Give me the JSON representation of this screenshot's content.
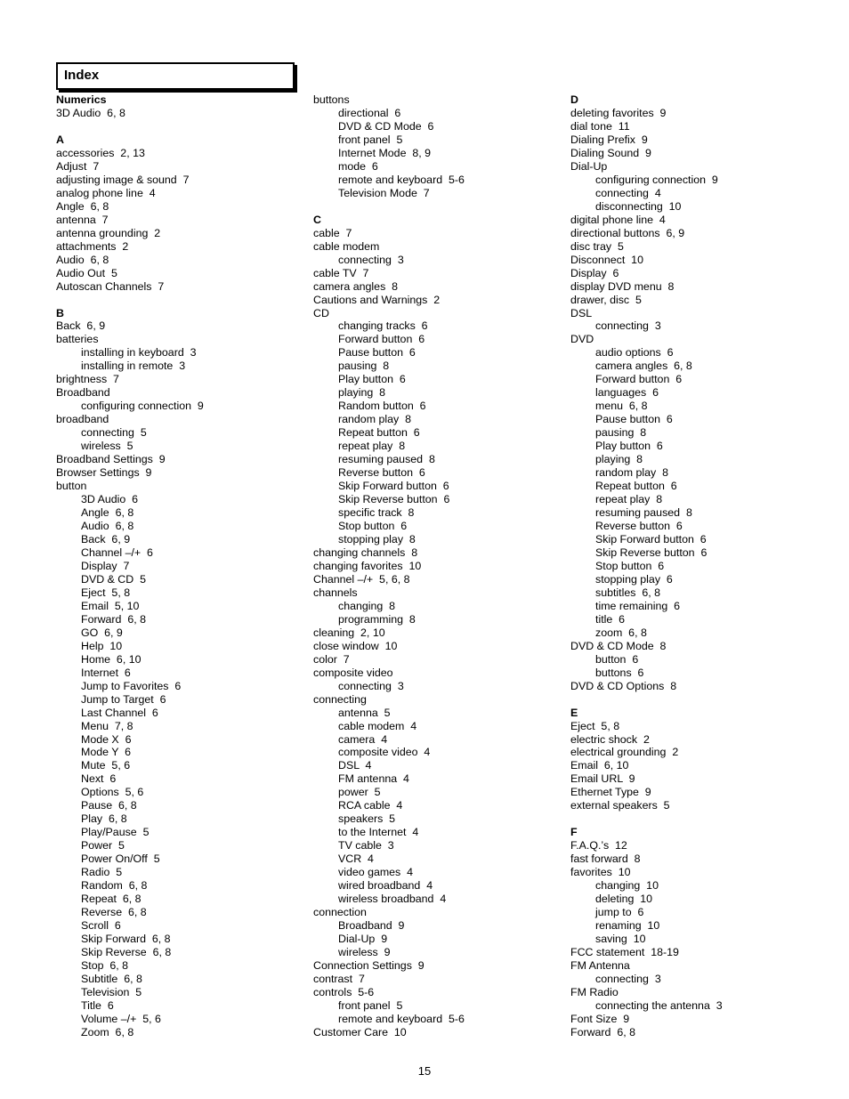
{
  "title": "Index",
  "page_number": "15",
  "columns": [
    [
      {
        "t": "Numerics",
        "k": "head"
      },
      {
        "t": "3D Audio  6, 8"
      },
      {
        "t": "",
        "k": "blank"
      },
      {
        "t": "A",
        "k": "head"
      },
      {
        "t": "accessories  2, 13"
      },
      {
        "t": "Adjust  7"
      },
      {
        "t": "adjusting image & sound  7"
      },
      {
        "t": "analog phone line  4"
      },
      {
        "t": "Angle  6, 8"
      },
      {
        "t": "antenna  7"
      },
      {
        "t": "antenna grounding  2"
      },
      {
        "t": "attachments  2"
      },
      {
        "t": "Audio  6, 8"
      },
      {
        "t": "Audio Out  5"
      },
      {
        "t": "Autoscan Channels  7"
      },
      {
        "t": "",
        "k": "blank"
      },
      {
        "t": "B",
        "k": "head"
      },
      {
        "t": "Back  6, 9"
      },
      {
        "t": "batteries"
      },
      {
        "t": "installing in keyboard  3",
        "k": "sub"
      },
      {
        "t": "installing in remote  3",
        "k": "sub"
      },
      {
        "t": "brightness  7"
      },
      {
        "t": "Broadband"
      },
      {
        "t": "configuring connection  9",
        "k": "sub"
      },
      {
        "t": "broadband"
      },
      {
        "t": "connecting  5",
        "k": "sub"
      },
      {
        "t": "wireless  5",
        "k": "sub"
      },
      {
        "t": "Broadband Settings  9"
      },
      {
        "t": "Browser Settings  9"
      },
      {
        "t": "button"
      },
      {
        "t": "3D Audio  6",
        "k": "sub"
      },
      {
        "t": "Angle  6, 8",
        "k": "sub"
      },
      {
        "t": "Audio  6, 8",
        "k": "sub"
      },
      {
        "t": "Back  6, 9",
        "k": "sub"
      },
      {
        "t": "Channel –/+  6",
        "k": "sub"
      },
      {
        "t": "Display  7",
        "k": "sub"
      },
      {
        "t": "DVD & CD  5",
        "k": "sub"
      },
      {
        "t": "Eject  5, 8",
        "k": "sub"
      },
      {
        "t": "Email  5, 10",
        "k": "sub"
      },
      {
        "t": "Forward  6, 8",
        "k": "sub"
      },
      {
        "t": "GO  6, 9",
        "k": "sub"
      },
      {
        "t": "Help  10",
        "k": "sub"
      },
      {
        "t": "Home  6, 10",
        "k": "sub"
      },
      {
        "t": "Internet  6",
        "k": "sub"
      },
      {
        "t": "Jump to Favorites  6",
        "k": "sub"
      },
      {
        "t": "Jump to Target  6",
        "k": "sub"
      },
      {
        "t": "Last Channel  6",
        "k": "sub"
      },
      {
        "t": "Menu  7, 8",
        "k": "sub"
      },
      {
        "t": "Mode X  6",
        "k": "sub"
      },
      {
        "t": "Mode Y  6",
        "k": "sub"
      },
      {
        "t": "Mute  5, 6",
        "k": "sub"
      },
      {
        "t": "Next  6",
        "k": "sub"
      },
      {
        "t": "Options  5, 6",
        "k": "sub"
      },
      {
        "t": "Pause  6, 8",
        "k": "sub"
      },
      {
        "t": "Play  6, 8",
        "k": "sub"
      },
      {
        "t": "Play/Pause  5",
        "k": "sub"
      },
      {
        "t": "Power  5",
        "k": "sub"
      },
      {
        "t": "Power On/Off  5",
        "k": "sub"
      },
      {
        "t": "Radio  5",
        "k": "sub"
      },
      {
        "t": "Random  6, 8",
        "k": "sub"
      },
      {
        "t": "Repeat  6, 8",
        "k": "sub"
      },
      {
        "t": "Reverse  6, 8",
        "k": "sub"
      },
      {
        "t": "Scroll  6",
        "k": "sub"
      },
      {
        "t": "Skip Forward  6, 8",
        "k": "sub"
      },
      {
        "t": "Skip Reverse  6, 8",
        "k": "sub"
      },
      {
        "t": "Stop  6, 8",
        "k": "sub"
      },
      {
        "t": "Subtitle  6, 8",
        "k": "sub"
      },
      {
        "t": "Television  5",
        "k": "sub"
      },
      {
        "t": "Title  6",
        "k": "sub"
      },
      {
        "t": "Volume –/+  5, 6",
        "k": "sub"
      },
      {
        "t": "Zoom  6, 8",
        "k": "sub"
      }
    ],
    [
      {
        "t": "buttons"
      },
      {
        "t": "directional  6",
        "k": "sub"
      },
      {
        "t": "DVD & CD Mode  6",
        "k": "sub"
      },
      {
        "t": "front panel  5",
        "k": "sub"
      },
      {
        "t": "Internet Mode  8, 9",
        "k": "sub"
      },
      {
        "t": "mode  6",
        "k": "sub"
      },
      {
        "t": "remote and keyboard  5-6",
        "k": "sub"
      },
      {
        "t": "Television Mode  7",
        "k": "sub"
      },
      {
        "t": "",
        "k": "blank"
      },
      {
        "t": "C",
        "k": "head"
      },
      {
        "t": "cable  7"
      },
      {
        "t": "cable modem"
      },
      {
        "t": "connecting  3",
        "k": "sub"
      },
      {
        "t": "cable TV  7"
      },
      {
        "t": "camera angles  8"
      },
      {
        "t": "Cautions and Warnings  2"
      },
      {
        "t": "CD"
      },
      {
        "t": "changing tracks  6",
        "k": "sub"
      },
      {
        "t": "Forward button  6",
        "k": "sub"
      },
      {
        "t": "Pause button  6",
        "k": "sub"
      },
      {
        "t": "pausing  8",
        "k": "sub"
      },
      {
        "t": "Play button  6",
        "k": "sub"
      },
      {
        "t": "playing  8",
        "k": "sub"
      },
      {
        "t": "Random button  6",
        "k": "sub"
      },
      {
        "t": "random play  8",
        "k": "sub"
      },
      {
        "t": "Repeat button  6",
        "k": "sub"
      },
      {
        "t": "repeat play  8",
        "k": "sub"
      },
      {
        "t": "resuming paused  8",
        "k": "sub"
      },
      {
        "t": "Reverse button  6",
        "k": "sub"
      },
      {
        "t": "Skip Forward button  6",
        "k": "sub"
      },
      {
        "t": "Skip Reverse button  6",
        "k": "sub"
      },
      {
        "t": "specific track  8",
        "k": "sub"
      },
      {
        "t": "Stop button  6",
        "k": "sub"
      },
      {
        "t": "stopping play  8",
        "k": "sub"
      },
      {
        "t": "changing channels  8"
      },
      {
        "t": "changing favorites  10"
      },
      {
        "t": "Channel –/+  5, 6, 8"
      },
      {
        "t": "channels"
      },
      {
        "t": "changing  8",
        "k": "sub"
      },
      {
        "t": "programming  8",
        "k": "sub"
      },
      {
        "t": "cleaning  2, 10"
      },
      {
        "t": "close window  10"
      },
      {
        "t": "color  7"
      },
      {
        "t": "composite video"
      },
      {
        "t": "connecting  3",
        "k": "sub"
      },
      {
        "t": "connecting"
      },
      {
        "t": "antenna  5",
        "k": "sub"
      },
      {
        "t": "cable modem  4",
        "k": "sub"
      },
      {
        "t": "camera  4",
        "k": "sub"
      },
      {
        "t": "composite video  4",
        "k": "sub"
      },
      {
        "t": "DSL  4",
        "k": "sub"
      },
      {
        "t": "FM antenna  4",
        "k": "sub"
      },
      {
        "t": "power  5",
        "k": "sub"
      },
      {
        "t": "RCA cable  4",
        "k": "sub"
      },
      {
        "t": "speakers  5",
        "k": "sub"
      },
      {
        "t": "to the Internet  4",
        "k": "sub"
      },
      {
        "t": "TV cable  3",
        "k": "sub"
      },
      {
        "t": "VCR  4",
        "k": "sub"
      },
      {
        "t": "video games  4",
        "k": "sub"
      },
      {
        "t": "wired broadband  4",
        "k": "sub"
      },
      {
        "t": "wireless broadband  4",
        "k": "sub"
      },
      {
        "t": "connection"
      },
      {
        "t": "Broadband  9",
        "k": "sub"
      },
      {
        "t": "Dial-Up  9",
        "k": "sub"
      },
      {
        "t": "wireless  9",
        "k": "sub"
      },
      {
        "t": "Connection Settings  9"
      },
      {
        "t": "contrast  7"
      },
      {
        "t": "controls  5-6"
      },
      {
        "t": "front panel  5",
        "k": "sub"
      },
      {
        "t": "remote and keyboard  5-6",
        "k": "sub"
      },
      {
        "t": "Customer Care  10"
      }
    ],
    [
      {
        "t": "D",
        "k": "head"
      },
      {
        "t": "deleting favorites  9"
      },
      {
        "t": "dial tone  11"
      },
      {
        "t": "Dialing Prefix  9"
      },
      {
        "t": "Dialing Sound  9"
      },
      {
        "t": "Dial-Up"
      },
      {
        "t": "configuring connection  9",
        "k": "sub"
      },
      {
        "t": "connecting  4",
        "k": "sub"
      },
      {
        "t": "disconnecting  10",
        "k": "sub"
      },
      {
        "t": "digital phone line  4"
      },
      {
        "t": "directional buttons  6, 9"
      },
      {
        "t": "disc tray  5"
      },
      {
        "t": "Disconnect  10"
      },
      {
        "t": "Display  6"
      },
      {
        "t": "display DVD menu  8"
      },
      {
        "t": "drawer, disc  5"
      },
      {
        "t": "DSL"
      },
      {
        "t": "connecting  3",
        "k": "sub"
      },
      {
        "t": "DVD"
      },
      {
        "t": "audio options  6",
        "k": "sub"
      },
      {
        "t": "camera angles  6, 8",
        "k": "sub"
      },
      {
        "t": "Forward button  6",
        "k": "sub"
      },
      {
        "t": "languages  6",
        "k": "sub"
      },
      {
        "t": "menu  6, 8",
        "k": "sub"
      },
      {
        "t": "Pause button  6",
        "k": "sub"
      },
      {
        "t": "pausing  8",
        "k": "sub"
      },
      {
        "t": "Play button  6",
        "k": "sub"
      },
      {
        "t": "playing  8",
        "k": "sub"
      },
      {
        "t": "random play  8",
        "k": "sub"
      },
      {
        "t": "Repeat button  6",
        "k": "sub"
      },
      {
        "t": "repeat play  8",
        "k": "sub"
      },
      {
        "t": "resuming paused  8",
        "k": "sub"
      },
      {
        "t": "Reverse button  6",
        "k": "sub"
      },
      {
        "t": "Skip Forward button  6",
        "k": "sub"
      },
      {
        "t": "Skip Reverse button  6",
        "k": "sub"
      },
      {
        "t": "Stop button  6",
        "k": "sub"
      },
      {
        "t": "stopping play  6",
        "k": "sub"
      },
      {
        "t": "subtitles  6, 8",
        "k": "sub"
      },
      {
        "t": "time remaining  6",
        "k": "sub"
      },
      {
        "t": "title  6",
        "k": "sub"
      },
      {
        "t": "zoom  6, 8",
        "k": "sub"
      },
      {
        "t": "DVD & CD Mode  8"
      },
      {
        "t": "button  6",
        "k": "sub"
      },
      {
        "t": "buttons  6",
        "k": "sub"
      },
      {
        "t": "DVD & CD Options  8"
      },
      {
        "t": "",
        "k": "blank"
      },
      {
        "t": "E",
        "k": "head"
      },
      {
        "t": "Eject  5, 8"
      },
      {
        "t": "electric shock  2"
      },
      {
        "t": "electrical grounding  2"
      },
      {
        "t": "Email  6, 10"
      },
      {
        "t": "Email URL  9"
      },
      {
        "t": "Ethernet Type  9"
      },
      {
        "t": "external speakers  5"
      },
      {
        "t": "",
        "k": "blank"
      },
      {
        "t": "F",
        "k": "head"
      },
      {
        "t": "F.A.Q.’s  12"
      },
      {
        "t": "fast forward  8"
      },
      {
        "t": "favorites  10"
      },
      {
        "t": "changing  10",
        "k": "sub"
      },
      {
        "t": "deleting  10",
        "k": "sub"
      },
      {
        "t": "jump to  6",
        "k": "sub"
      },
      {
        "t": "renaming  10",
        "k": "sub"
      },
      {
        "t": "saving  10",
        "k": "sub"
      },
      {
        "t": "FCC statement  18-19"
      },
      {
        "t": "FM Antenna"
      },
      {
        "t": "connecting  3",
        "k": "sub"
      },
      {
        "t": "FM Radio"
      },
      {
        "t": "connecting the antenna  3",
        "k": "sub"
      },
      {
        "t": "Font Size  9"
      },
      {
        "t": "Forward  6, 8"
      }
    ]
  ]
}
